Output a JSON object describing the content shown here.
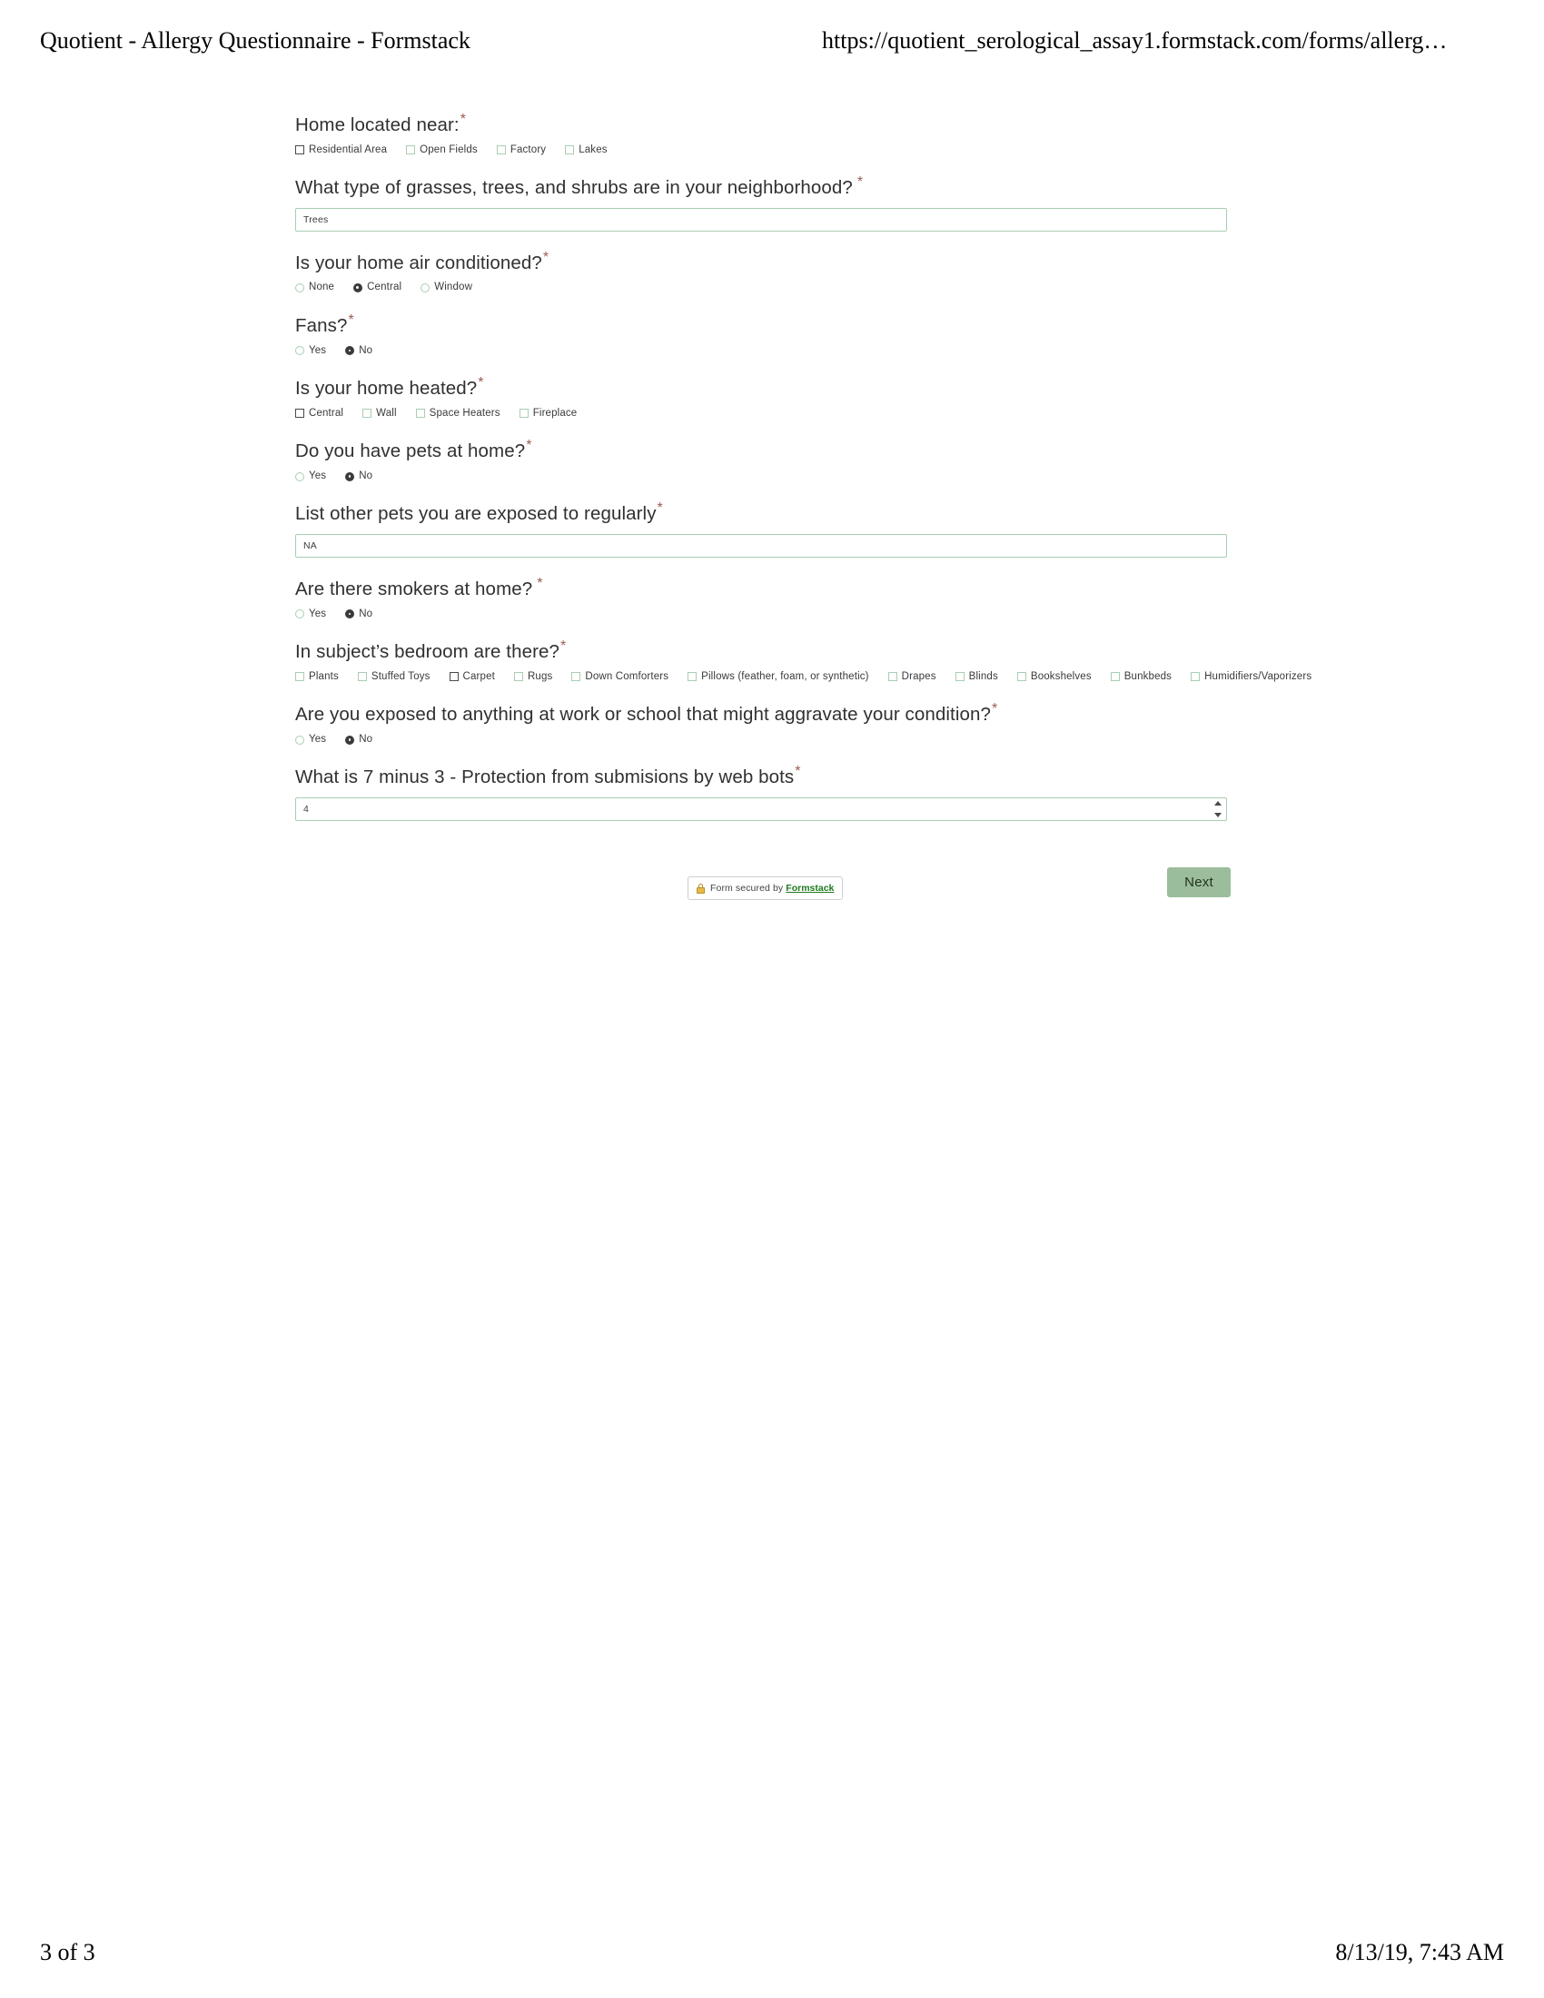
{
  "print_header": {
    "title": "Quotient - Allergy Questionnaire - Formstack",
    "url": "https://quotient_serological_assay1.formstack.com/forms/allerg…"
  },
  "print_footer": {
    "page": "3 of 3",
    "timestamp": "8/13/19, 7:43 AM"
  },
  "form": {
    "required_marker": "*",
    "fields": [
      {
        "label": "Home located near:",
        "type": "checkbox",
        "options": [
          {
            "label": "Residential Area",
            "checked": true
          },
          {
            "label": "Open Fields",
            "checked": false
          },
          {
            "label": "Factory",
            "checked": false
          },
          {
            "label": "Lakes",
            "checked": false
          }
        ]
      },
      {
        "label": "What type of grasses, trees, and shrubs are in your neighborhood?",
        "type": "text",
        "value": "Trees",
        "placeholder": ""
      },
      {
        "label": "Is your home air conditioned?",
        "type": "radio",
        "options": [
          {
            "label": "None",
            "selected": false
          },
          {
            "label": "Central",
            "selected": true
          },
          {
            "label": "Window",
            "selected": false
          }
        ]
      },
      {
        "label": "Fans?",
        "type": "radio",
        "options": [
          {
            "label": "Yes",
            "selected": false
          },
          {
            "label": "No",
            "selected": true
          }
        ]
      },
      {
        "label": "Is your home heated?",
        "type": "checkbox",
        "options": [
          {
            "label": "Central",
            "checked": true
          },
          {
            "label": "Wall",
            "checked": false
          },
          {
            "label": "Space Heaters",
            "checked": false
          },
          {
            "label": "Fireplace",
            "checked": false
          }
        ]
      },
      {
        "label": "Do you have pets at home?",
        "type": "radio",
        "options": [
          {
            "label": "Yes",
            "selected": false
          },
          {
            "label": "No",
            "selected": true
          }
        ]
      },
      {
        "label": "List other pets you are exposed to regularly",
        "type": "text",
        "value": "NA",
        "placeholder": ""
      },
      {
        "label": "Are there smokers at home?",
        "type": "radio",
        "options": [
          {
            "label": "Yes",
            "selected": false
          },
          {
            "label": "No",
            "selected": true
          }
        ]
      },
      {
        "label": "In subject’s bedroom are there?",
        "type": "checkbox",
        "options": [
          {
            "label": "Plants",
            "checked": false
          },
          {
            "label": "Stuffed Toys",
            "checked": false
          },
          {
            "label": "Carpet",
            "checked": true
          },
          {
            "label": "Rugs",
            "checked": false
          },
          {
            "label": "Down Comforters",
            "checked": false
          },
          {
            "label": "Pillows (feather, foam, or synthetic)",
            "checked": false
          },
          {
            "label": "Drapes",
            "checked": false
          },
          {
            "label": "Blinds",
            "checked": false
          },
          {
            "label": "Bookshelves",
            "checked": false
          },
          {
            "label": "Bunkbeds",
            "checked": false
          },
          {
            "label": "Humidifiers/Vaporizers",
            "checked": false
          }
        ]
      },
      {
        "label": "Are you exposed to anything at work or school that might aggravate your condition?",
        "type": "radio",
        "options": [
          {
            "label": "Yes",
            "selected": false
          },
          {
            "label": "No",
            "selected": true
          }
        ]
      },
      {
        "label": "What is 7 minus 3 - Protection from submisions by web bots",
        "type": "number",
        "value": "4",
        "placeholder": ""
      }
    ],
    "security_badge": {
      "prefix": "Form secured by",
      "brand": "Formstack"
    },
    "next_label": "Next"
  },
  "colors": {
    "accent_green": "#a8ceb2",
    "button_green": "#9bbd9b",
    "required_red": "#9c5b55",
    "link_green": "#1f7a1f"
  }
}
